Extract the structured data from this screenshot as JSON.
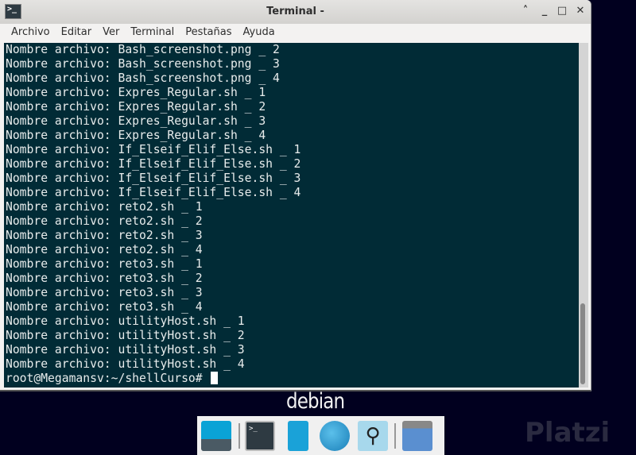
{
  "window": {
    "title": "Terminal -",
    "app_icon": "terminal-icon"
  },
  "menu": [
    "Archivo",
    "Editar",
    "Ver",
    "Terminal",
    "Pestañas",
    "Ayuda"
  ],
  "terminal": {
    "lines": [
      "Nombre archivo: Bash_screenshot.png _ 2",
      "Nombre archivo: Bash_screenshot.png _ 3",
      "Nombre archivo: Bash_screenshot.png _ 4",
      "Nombre archivo: Expres_Regular.sh _ 1",
      "Nombre archivo: Expres_Regular.sh _ 2",
      "Nombre archivo: Expres_Regular.sh _ 3",
      "Nombre archivo: Expres_Regular.sh _ 4",
      "Nombre archivo: If_Elseif_Elif_Else.sh _ 1",
      "Nombre archivo: If_Elseif_Elif_Else.sh _ 2",
      "Nombre archivo: If_Elseif_Elif_Else.sh _ 3",
      "Nombre archivo: If_Elseif_Elif_Else.sh _ 4",
      "Nombre archivo: reto2.sh _ 1",
      "Nombre archivo: reto2.sh _ 2",
      "Nombre archivo: reto2.sh _ 3",
      "Nombre archivo: reto2.sh _ 4",
      "Nombre archivo: reto3.sh _ 1",
      "Nombre archivo: reto3.sh _ 2",
      "Nombre archivo: reto3.sh _ 3",
      "Nombre archivo: reto3.sh _ 4",
      "Nombre archivo: utilityHost.sh _ 1",
      "Nombre archivo: utilityHost.sh _ 2",
      "Nombre archivo: utilityHost.sh _ 3",
      "Nombre archivo: utilityHost.sh _ 4"
    ],
    "prompt": "root@Megamansv:~/shellCurso# ",
    "bg": "#012b36"
  },
  "desktop": {
    "logo": "debian",
    "watermark": "Platzi"
  },
  "dock": [
    "show-desktop-icon",
    "terminal-icon",
    "file-cabinet-icon",
    "web-browser-icon",
    "app-finder-icon",
    "folder-icon"
  ]
}
